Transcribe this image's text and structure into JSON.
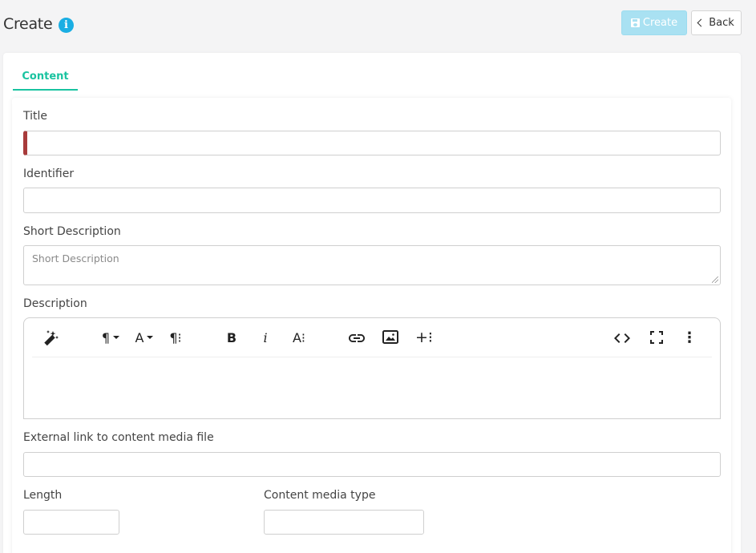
{
  "header": {
    "title": "Create",
    "info_icon": "info-icon",
    "create_label": "Create",
    "back_label": "Back"
  },
  "tabs": [
    {
      "label": "Content",
      "active": true
    }
  ],
  "form": {
    "title_label": "Title",
    "title_value": "",
    "identifier_label": "Identifier",
    "identifier_value": "",
    "short_description_label": "Short Description",
    "short_description_placeholder": "Short Description",
    "description_label": "Description",
    "external_link_label": "External link to content media file",
    "external_link_value": "",
    "length_label": "Length",
    "length_value": "",
    "media_type_label": "Content media type",
    "media_type_value": ""
  },
  "editor_toolbar": {
    "paragraph_glyph": "¶",
    "font_glyph": "A",
    "paragraph_format_glyph": "¶⁝",
    "bold_glyph": "B",
    "italic_glyph": "i",
    "text_size_glyph": "A⁝",
    "insert_more_glyph": "+⁝",
    "more_glyph": "⋮",
    "icons": [
      "magic-wand-icon",
      "paragraph-icon",
      "font-color-icon",
      "paragraph-format-icon",
      "bold-icon",
      "italic-icon",
      "text-size-icon",
      "link-icon",
      "image-icon",
      "insert-more-icon",
      "code-view-icon",
      "fullscreen-icon",
      "more-vertical-icon"
    ]
  },
  "colors": {
    "accent_tab": "#19c3a0",
    "create_button": "#a9e1f2",
    "info_icon": "#1aaee3",
    "required_marker": "#a83b3b"
  }
}
